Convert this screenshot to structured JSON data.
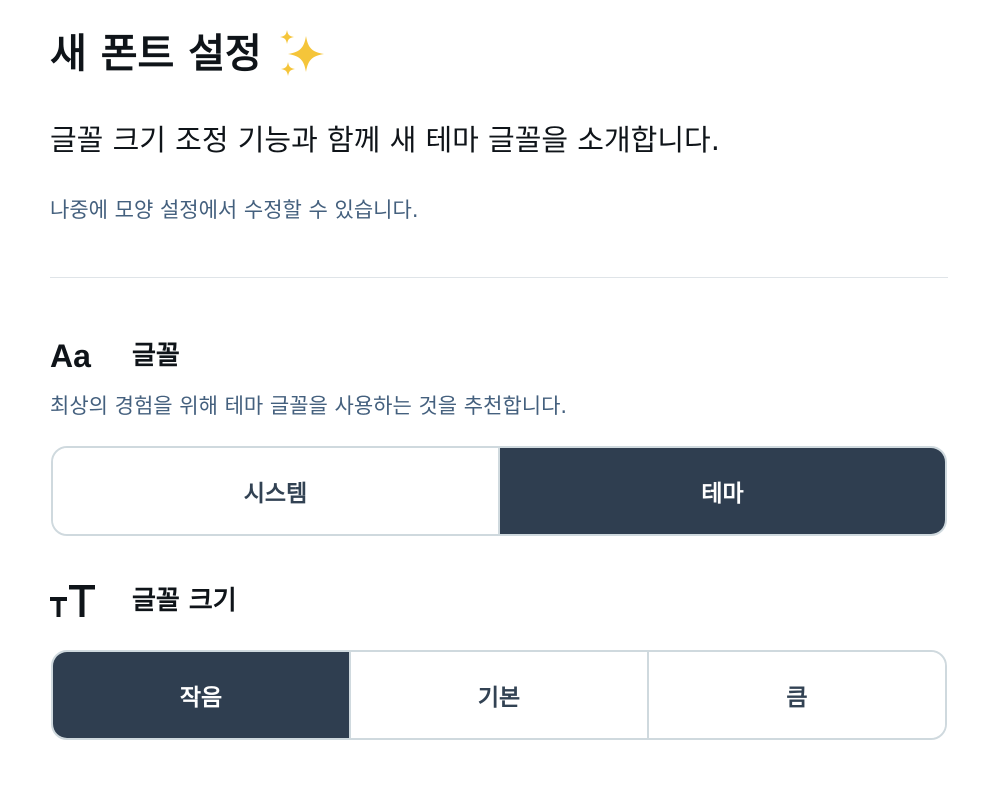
{
  "header": {
    "title": "새 폰트 설정",
    "sparkle_icon": "sparkles-icon"
  },
  "intro_text": "글꼴 크기 조정 기능과 함께 새 테마 글꼴을 소개합니다.",
  "note_text": "나중에 모양 설정에서 수정할 수 있습니다.",
  "font_section": {
    "icon_text": "Aa",
    "label": "글꼴",
    "description": "최상의 경험을 위해 테마 글꼴을 사용하는 것을 추천합니다.",
    "options": [
      {
        "label": "시스템",
        "selected": false
      },
      {
        "label": "테마",
        "selected": true
      }
    ]
  },
  "size_section": {
    "icon": "text-size-icon",
    "label": "글꼴 크기",
    "options": [
      {
        "label": "작음",
        "selected": true
      },
      {
        "label": "기본",
        "selected": false
      },
      {
        "label": "큼",
        "selected": false
      }
    ]
  },
  "colors": {
    "selected_bg": "#2f3e50",
    "muted_text": "#44607e",
    "border": "#cfd9de",
    "sparkle": "#f5c53a"
  }
}
